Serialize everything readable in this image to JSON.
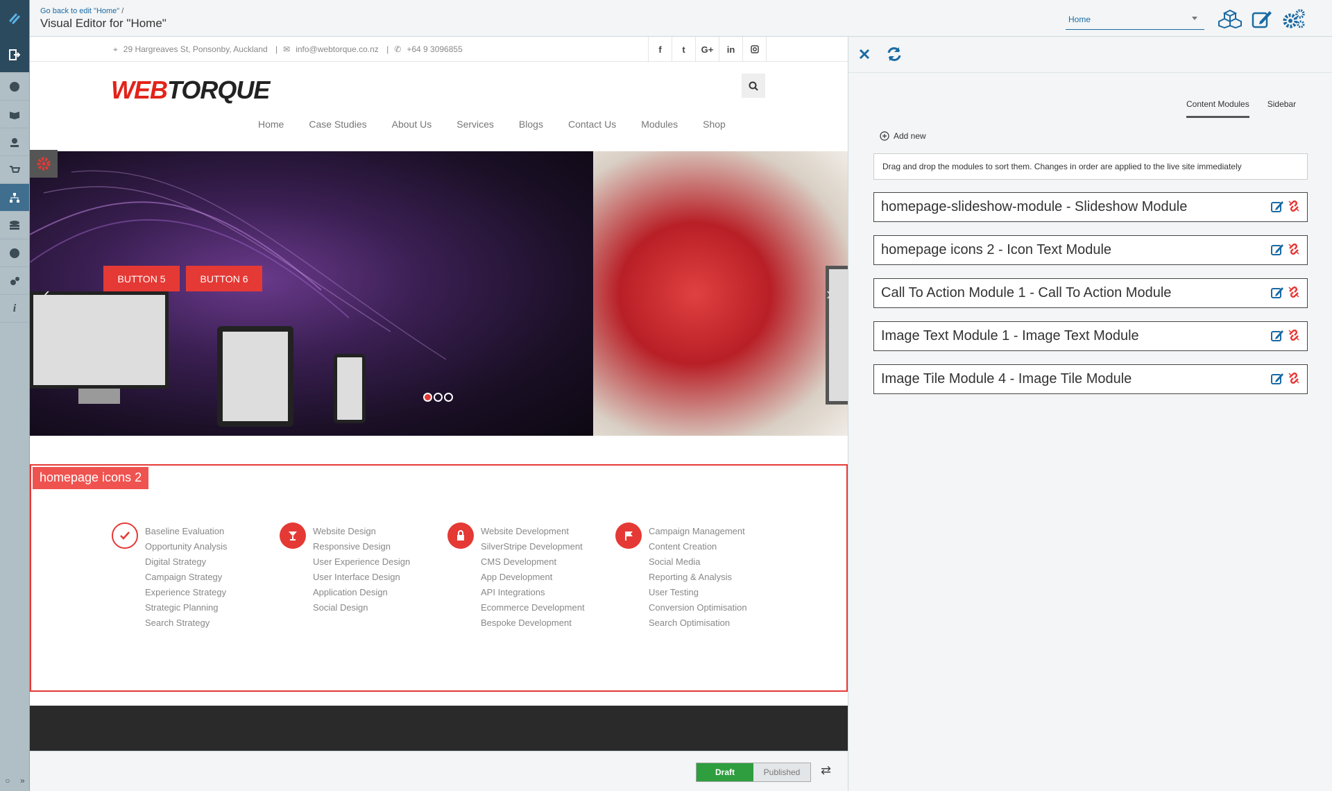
{
  "topbar": {
    "breadcrumb_link": "Go back to edit \"Home\"",
    "breadcrumb_sep": "/",
    "title": "Visual Editor for \"Home\"",
    "page_select_value": "Home"
  },
  "site": {
    "address": "29 Hargreaves St, Ponsonby, Auckland",
    "email": "info@webtorque.co.nz",
    "phone": "+64 9 3096855",
    "social": [
      "f",
      "t",
      "G+",
      "in",
      "ig"
    ],
    "brand_part1": "WEB",
    "brand_part2": "TORQUE",
    "nav": [
      "Home",
      "Case Studies",
      "About Us",
      "Services",
      "Blogs",
      "Contact Us",
      "Modules",
      "Shop"
    ],
    "slider_buttons": [
      "BUTTON 5",
      "BUTTON 6"
    ],
    "icons_section_label": "homepage icons 2",
    "icon_columns": [
      {
        "icon": "check-icon",
        "color": "#e53935",
        "items": [
          "Baseline Evaluation",
          "Opportunity Analysis",
          "Digital Strategy",
          "Campaign Strategy",
          "Experience Strategy",
          "Strategic Planning",
          "Search Strategy"
        ]
      },
      {
        "icon": "cocktail-icon",
        "color": "#e53935",
        "items": [
          "Website Design",
          "Responsive Design",
          "User Experience Design",
          "User Interface Design",
          "Application Design",
          "Social Design"
        ]
      },
      {
        "icon": "lock-icon",
        "color": "#e53935",
        "items": [
          "Website Development",
          "SilverStripe Development",
          "CMS Development",
          "App Development",
          "API Integrations",
          "Ecommerce Development",
          "Bespoke Development"
        ]
      },
      {
        "icon": "flag-icon",
        "color": "#e53935",
        "items": [
          "Campaign Management",
          "Content Creation",
          "Social Media",
          "Reporting & Analysis",
          "User Testing",
          "Conversion Optimisation",
          "Search Optimisation"
        ]
      }
    ]
  },
  "footer": {
    "draft_label": "Draft",
    "published_label": "Published"
  },
  "panel": {
    "tabs": [
      "Content Modules",
      "Sidebar"
    ],
    "add_new_label": "Add new",
    "notice": "Drag and drop the modules to sort them. Changes in order are applied to the live site immediately",
    "modules": [
      "homepage-slideshow-module - Slideshow Module",
      "homepage icons 2 - Icon Text Module",
      "Call To Action Module 1 - Call To Action Module",
      "Image Text Module 1 - Image Text Module",
      "Image Tile Module 4 - Image Tile Module"
    ]
  },
  "colors": {
    "accent_blue": "#1a6aa3",
    "brand_red": "#e2231a",
    "draft_green": "#2e9e3f",
    "rail_dark": "#2c4a5e"
  }
}
